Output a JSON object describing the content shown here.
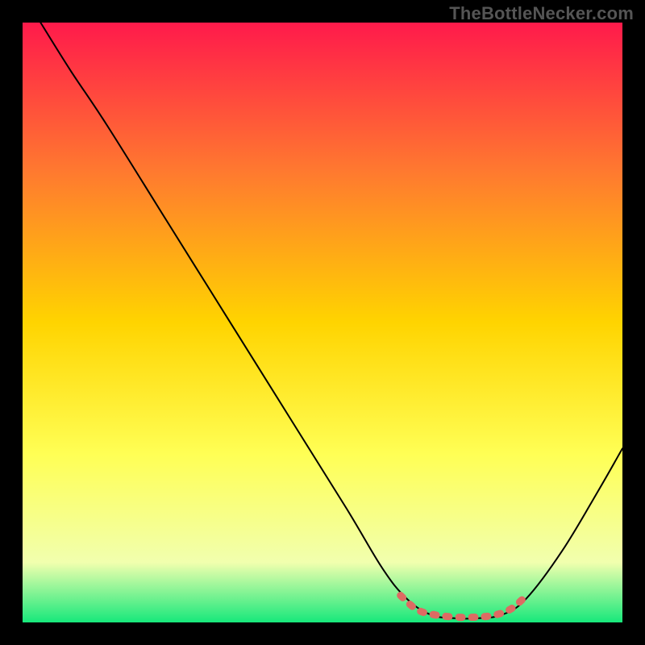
{
  "watermark": "TheBottleNecker.com",
  "chart_data": {
    "type": "line",
    "title": "",
    "xlabel": "",
    "ylabel": "",
    "xlim": [
      0,
      100
    ],
    "ylim": [
      0,
      100
    ],
    "background_gradient": {
      "top": "#ff1a4b",
      "upper_mid": "#ff7a2f",
      "mid": "#ffd400",
      "lower_mid": "#ffff55",
      "lower": "#f1ffae",
      "bottom": "#17e87b"
    },
    "series": [
      {
        "name": "bottleneck-curve",
        "color": "#000000",
        "points": [
          {
            "x": 3.0,
            "y": 100.0
          },
          {
            "x": 8.0,
            "y": 92.0
          },
          {
            "x": 14.0,
            "y": 83.0
          },
          {
            "x": 24.0,
            "y": 67.0
          },
          {
            "x": 34.0,
            "y": 51.0
          },
          {
            "x": 44.0,
            "y": 35.0
          },
          {
            "x": 54.0,
            "y": 19.0
          },
          {
            "x": 60.0,
            "y": 9.0
          },
          {
            "x": 64.0,
            "y": 4.0
          },
          {
            "x": 68.0,
            "y": 1.3
          },
          {
            "x": 72.0,
            "y": 0.7
          },
          {
            "x": 76.0,
            "y": 0.7
          },
          {
            "x": 80.0,
            "y": 1.3
          },
          {
            "x": 84.0,
            "y": 4.0
          },
          {
            "x": 90.0,
            "y": 12.0
          },
          {
            "x": 96.0,
            "y": 22.0
          },
          {
            "x": 100.0,
            "y": 29.0
          }
        ]
      },
      {
        "name": "optimal-band-marker",
        "color": "#dd6b63",
        "style": "dashed",
        "points": [
          {
            "x": 63.0,
            "y": 4.5
          },
          {
            "x": 65.5,
            "y": 2.3
          },
          {
            "x": 68.0,
            "y": 1.4
          },
          {
            "x": 72.0,
            "y": 0.9
          },
          {
            "x": 76.0,
            "y": 0.9
          },
          {
            "x": 79.0,
            "y": 1.3
          },
          {
            "x": 81.5,
            "y": 2.3
          },
          {
            "x": 83.5,
            "y": 4.0
          }
        ]
      }
    ]
  }
}
